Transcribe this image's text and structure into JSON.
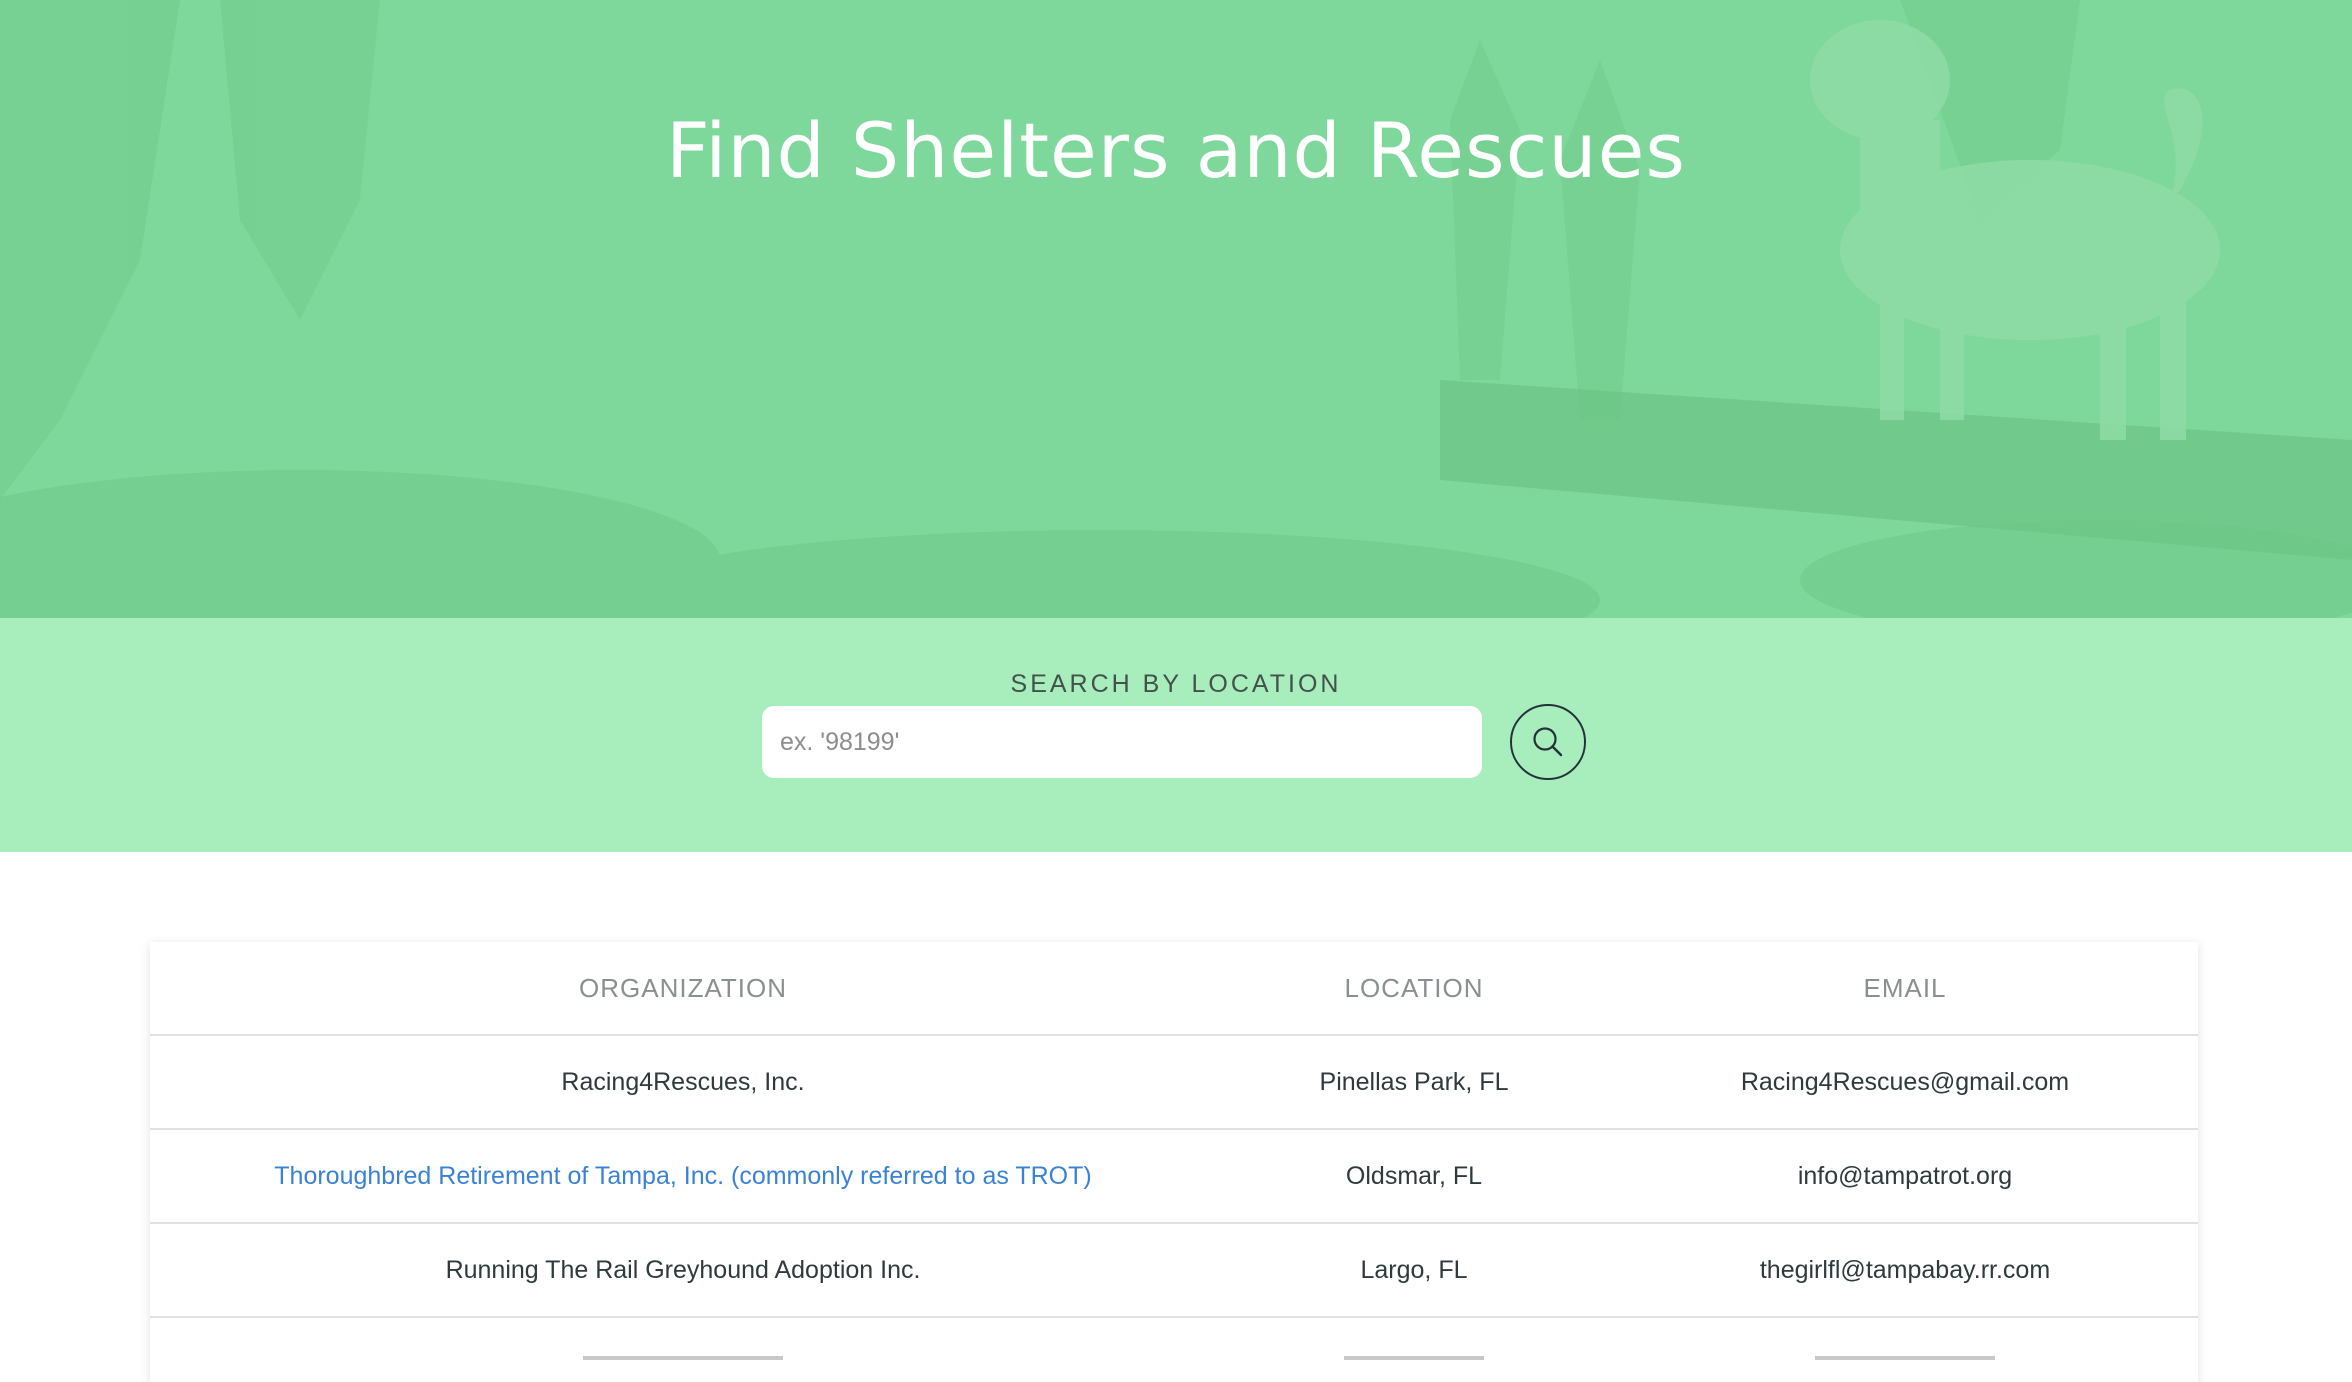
{
  "hero": {
    "title": "Find Shelters and Rescues"
  },
  "search": {
    "label": "SEARCH BY LOCATION",
    "placeholder": "ex. '98199'",
    "value": "",
    "button_icon": "search-icon"
  },
  "table": {
    "headers": [
      "ORGANIZATION",
      "LOCATION",
      "EMAIL"
    ],
    "rows": [
      {
        "organization": "Racing4Rescues, Inc.",
        "location": "Pinellas Park, FL",
        "email": "Racing4Rescues@gmail.com",
        "is_link": false
      },
      {
        "organization": "Thoroughbred Retirement of Tampa, Inc. (commonly referred to as TROT)",
        "location": "Oldsmar, FL",
        "email": "info@tampatrot.org",
        "is_link": true
      },
      {
        "organization": "Running The Rail Greyhound Adoption Inc.",
        "location": "Largo, FL",
        "email": "thegirlfl@tampabay.rr.com",
        "is_link": false
      }
    ]
  },
  "colors": {
    "hero_green": "#7fd89b",
    "search_band": "#a8edbc",
    "link_blue": "#3a82d6"
  }
}
